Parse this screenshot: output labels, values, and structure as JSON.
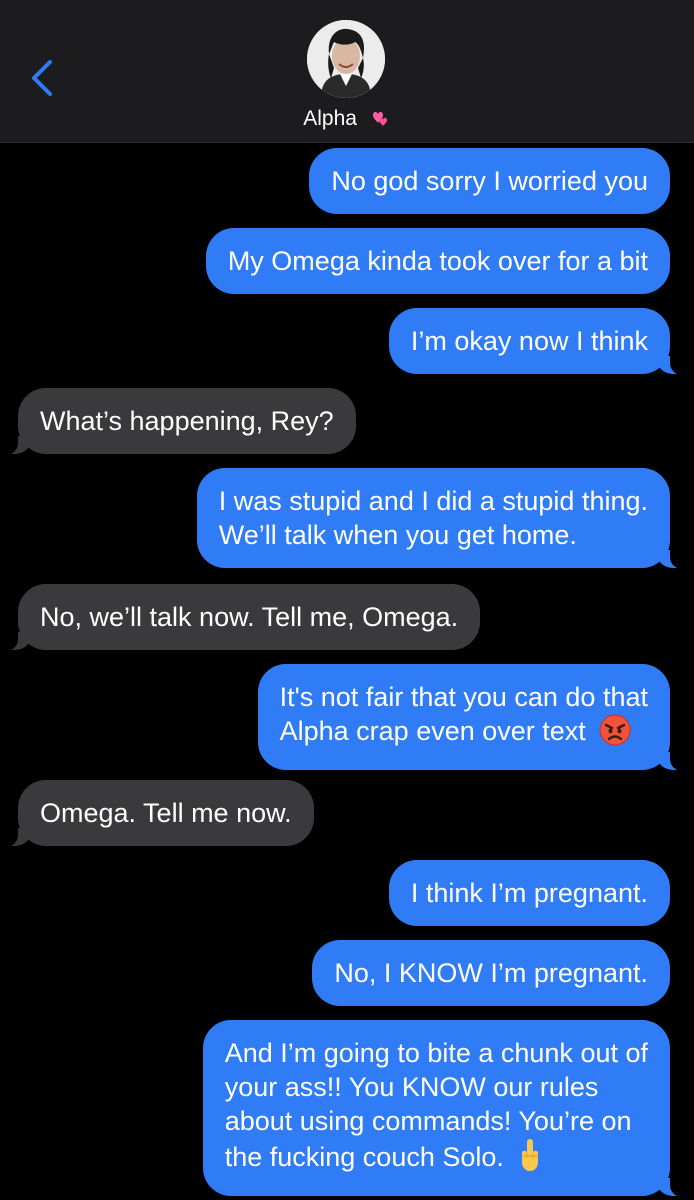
{
  "header": {
    "contact_name": "Alpha",
    "name_emoji": "two-hearts-icon",
    "accent_color": "#2f7cf6"
  },
  "messages": [
    {
      "from": "me",
      "text": "No god sorry I worried you"
    },
    {
      "from": "me",
      "text": "My Omega kinda took over for a bit"
    },
    {
      "from": "me",
      "text": "I’m okay now I think"
    },
    {
      "from": "them",
      "text": "What’s happening, Rey?"
    },
    {
      "from": "me",
      "lines": [
        "I was stupid and I did a stupid thing.",
        "We’ll talk when you get home."
      ]
    },
    {
      "from": "them",
      "text": "No, we’ll talk now. Tell me, Omega."
    },
    {
      "from": "me",
      "lines": [
        "It's not fair that you can do that",
        "Alpha crap even over text"
      ],
      "emoji": "angry-face-icon"
    },
    {
      "from": "them",
      "text": "Omega. Tell me now."
    },
    {
      "from": "me",
      "text": "I think I’m pregnant."
    },
    {
      "from": "me",
      "text": "No, I KNOW I’m pregnant."
    },
    {
      "from": "me",
      "lines": [
        "And I’m going to bite a chunk out of",
        "your ass!! You KNOW our rules",
        "about using commands! You’re on",
        "the fucking couch Solo."
      ],
      "emoji": "middle-finger-icon"
    }
  ],
  "colors": {
    "outgoing_bubble": "#2f7cf6",
    "incoming_bubble": "#3a3a3c",
    "header_bg": "#1c1c1e",
    "background": "#000000"
  }
}
